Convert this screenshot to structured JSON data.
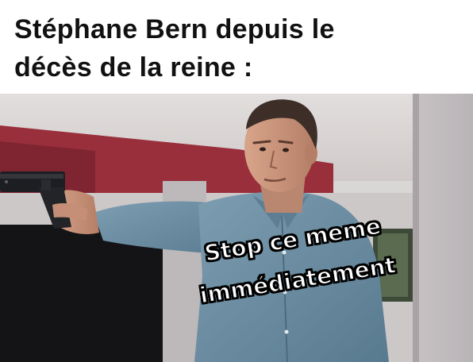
{
  "caption": {
    "line1": "Stéphane Bern depuis le",
    "line2": "décès de la reine :"
  },
  "overlay": {
    "line1": "Stop ce meme",
    "line2": "immédiatement"
  },
  "colors": {
    "caption_background": "#ffffff",
    "caption_text": "#111111",
    "wall_red": "#9a2f3c",
    "shirt_blue": "#6e8ea3",
    "overlay_text": "#ffffff",
    "overlay_outline": "#000000"
  },
  "icons": [
    "pistol-icon"
  ]
}
